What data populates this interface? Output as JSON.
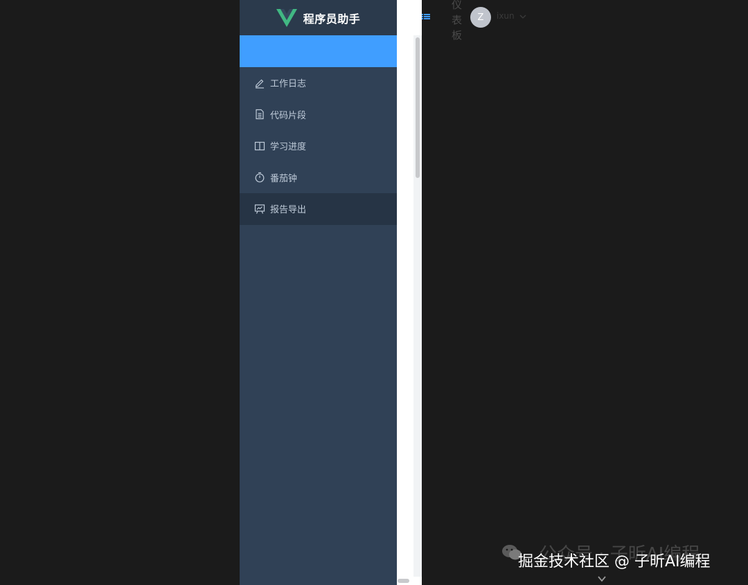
{
  "app": {
    "title": "程序员助手"
  },
  "sidebar": {
    "items": [
      {
        "label": "工作日志",
        "icon": "edit-icon"
      },
      {
        "label": "代码片段",
        "icon": "document-icon"
      },
      {
        "label": "学习进度",
        "icon": "book-icon"
      },
      {
        "label": "番茄钟",
        "icon": "timer-icon"
      },
      {
        "label": "报告导出",
        "icon": "presentation-icon"
      }
    ]
  },
  "header": {
    "title": "仪表板",
    "avatar_initial": "Z",
    "username": "ixun"
  },
  "watermark": {
    "faint": "公众号 · 子昕AI编程",
    "text": "掘金技术社区 @ 子昕AI编程"
  },
  "colors": {
    "sidebar_bg": "#304156",
    "active": "#409eff",
    "brand_green": "#41b883",
    "brand_dark": "#35495e"
  }
}
